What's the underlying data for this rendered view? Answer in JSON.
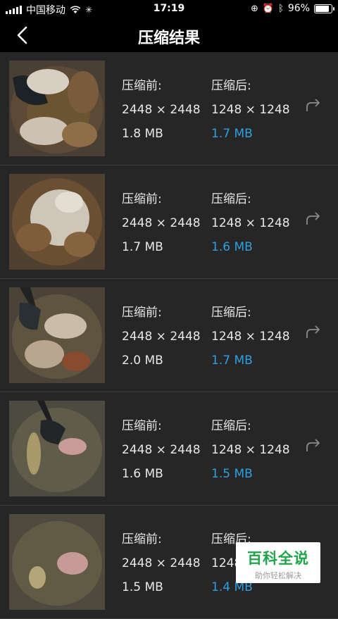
{
  "status_bar": {
    "carrier": "中国移动",
    "time": "17:19",
    "battery_text": "96%",
    "battery_level": 0.96
  },
  "nav": {
    "title": "压缩结果",
    "back_icon": "chevron-left-icon"
  },
  "colors": {
    "background": "#262626",
    "bar": "#000000",
    "accent": "#2f9fe0"
  },
  "results": [
    {
      "before_label": "压缩前:",
      "after_label": "压缩后:",
      "before_dims": "2448 × 2448",
      "after_dims": "1248 × 1248",
      "before_size": "1.8 MB",
      "after_size": "1.7 MB",
      "share_icon": "share-arrow-icon"
    },
    {
      "before_label": "压缩前:",
      "after_label": "压缩后:",
      "before_dims": "2448 × 2448",
      "after_dims": "1248 × 1248",
      "before_size": "1.7 MB",
      "after_size": "1.6 MB",
      "share_icon": "share-arrow-icon"
    },
    {
      "before_label": "压缩前:",
      "after_label": "压缩后:",
      "before_dims": "2448 × 2448",
      "after_dims": "1248 × 1248",
      "before_size": "2.0 MB",
      "after_size": "1.7 MB",
      "share_icon": "share-arrow-icon"
    },
    {
      "before_label": "压缩前:",
      "after_label": "压缩后:",
      "before_dims": "2448 × 2448",
      "after_dims": "1248 × 1248",
      "before_size": "1.6 MB",
      "after_size": "1.5 MB",
      "share_icon": "share-arrow-icon"
    },
    {
      "before_label": "压缩前:",
      "after_label": "压缩后:",
      "before_dims": "2448 × 2448",
      "after_dims": "1248",
      "before_size": "1.5 MB",
      "after_size": "1.4 MB",
      "share_icon": "share-arrow-icon"
    }
  ],
  "watermark": {
    "main": "百科全说",
    "sub": "助你轻松解决"
  }
}
